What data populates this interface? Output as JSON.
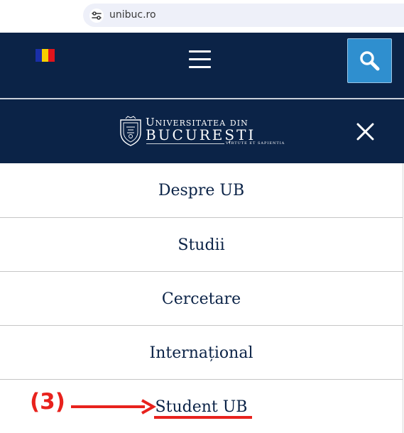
{
  "browser": {
    "url": "unibuc.ro"
  },
  "header": {
    "flag_colors": [
      "#1a2fa8",
      "#f5d000",
      "#e0141c"
    ],
    "search_icon": "search-icon",
    "menu_icon": "hamburger-icon"
  },
  "logo": {
    "line1": "Universitatea din",
    "line2": "București",
    "motto": "VIRTUTE ET SAPIENTIA"
  },
  "menu": {
    "close_icon": "close-icon",
    "items": [
      {
        "label": "Despre UB"
      },
      {
        "label": "Studii"
      },
      {
        "label": "Cercetare"
      },
      {
        "label": "Internațional"
      },
      {
        "label": "Student UB"
      }
    ]
  },
  "annotation": {
    "label": "(3)",
    "color": "#e8221d"
  },
  "colors": {
    "navy": "#0b2347",
    "search_blue": "#2f8fcf"
  }
}
